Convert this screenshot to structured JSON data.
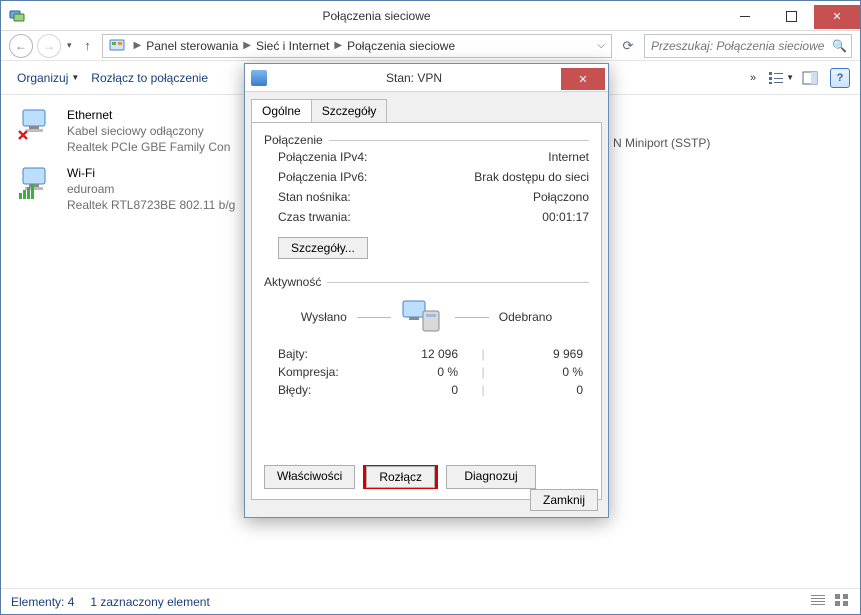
{
  "window": {
    "title": "Połączenia sieciowe"
  },
  "breadcrumbs": {
    "level0": "Panel sterowania",
    "level1": "Sieć i Internet",
    "level2": "Połączenia sieciowe"
  },
  "search": {
    "placeholder": "Przeszukaj: Połączenia sieciowe"
  },
  "toolbar": {
    "organize": "Organizuj",
    "disconnect": "Rozłącz to połączenie"
  },
  "connections": {
    "ethernet": {
      "name": "Ethernet",
      "status": "Kabel sieciowy odłączony",
      "adapter": "Realtek PCIe GBE Family Con"
    },
    "wifi": {
      "name": "Wi-Fi",
      "status": "eduroam",
      "adapter": "Realtek RTL8723BE 802.11 b/g"
    },
    "overflow": "N Miniport (SSTP)"
  },
  "dialog": {
    "title": "Stan: VPN",
    "tabs": {
      "general": "Ogólne",
      "details": "Szczegóły"
    },
    "group_connection": "Połączenie",
    "rows": {
      "ipv4_k": "Połączenia IPv4:",
      "ipv4_v": "Internet",
      "ipv6_k": "Połączenia IPv6:",
      "ipv6_v": "Brak dostępu do sieci",
      "media_k": "Stan nośnika:",
      "media_v": "Połączono",
      "dur_k": "Czas trwania:",
      "dur_v": "00:01:17"
    },
    "details_btn": "Szczegóły...",
    "group_activity": "Aktywność",
    "activity": {
      "sent_label": "Wysłano",
      "recv_label": "Odebrano",
      "rows": {
        "bytes_k": "Bajty:",
        "bytes_sent": "12 096",
        "bytes_recv": "9 969",
        "comp_k": "Kompresja:",
        "comp_sent": "0 %",
        "comp_recv": "0 %",
        "err_k": "Błędy:",
        "err_sent": "0",
        "err_recv": "0"
      }
    },
    "buttons": {
      "properties": "Właściwości",
      "disconnect": "Rozłącz",
      "diagnose": "Diagnozuj",
      "close": "Zamknij"
    }
  },
  "statusbar": {
    "elements": "Elementy: 4",
    "selected": "1 zaznaczony element"
  }
}
